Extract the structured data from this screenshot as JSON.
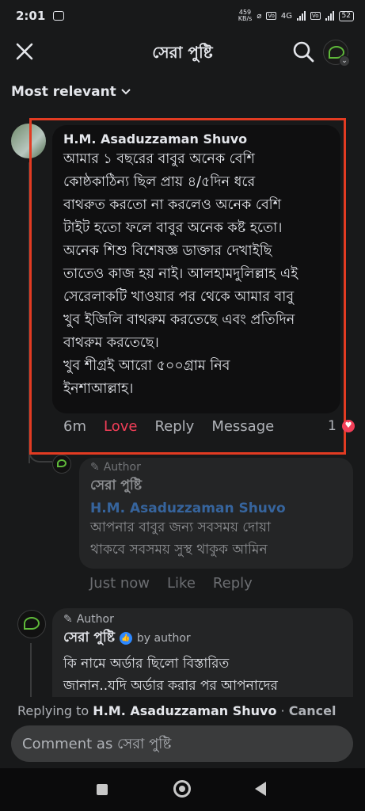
{
  "status_bar": {
    "time": "2:01",
    "net_speed": "459",
    "net_unit": "KB/s",
    "signal": "4G",
    "battery": "52"
  },
  "header": {
    "title": "সেরা পুষ্টি"
  },
  "sort": {
    "label": "Most relevant"
  },
  "comment": {
    "author": "H.M. Asaduzzaman Shuvo",
    "text": "আমার ১ বছরের বাবুর অনেক বেশি\nকোষ্ঠকাঠিন্য ছিল প্রায় ৪/৫দিন ধরে\nবাথরুত করতো না করলেও অনেক বেশি\nটাইট হতো ফলে বাবুর অনেক কষ্ট হতো।\nঅনেক শিশু বিশেষজ্ঞ ডাক্তার দেখাইছি\nতাতেও কাজ হয় নাই। আলহামদুলিল্লাহ এই\nসেরেলাকটি খাওয়ার পর থেকে আমার বাবু\nখুব ইজিলি বাথরুম করতেছে এবং প্রতিদিন\nবাথরুম করতেছে।\nখুব শীগ্রই আরো ৫০০গ্রাম নিব\nইনশাআল্লাহ।",
    "time": "6m",
    "love": "Love",
    "reply": "Reply",
    "message": "Message",
    "reaction_count": "1"
  },
  "reply1": {
    "tag": "Author",
    "author": "সেরা পুষ্টি",
    "mention": "H.M. Asaduzzaman Shuvo",
    "text": "আপনার বাবুর জন্য সবসময় দোয়া\nথাকবে সবসময় সুস্থ থাকুক আমিন",
    "time": "Just now",
    "like": "Like",
    "reply": "Reply"
  },
  "reply2": {
    "tag": "Author",
    "author": "সেরা পুষ্টি",
    "by_author": "by author",
    "text": "কি নামে অর্ডার ছিলো বিস্তারিত\nজানান..যদি অর্ডার করার পর আপনাদের"
  },
  "reply_bar": {
    "prefix": "Replying to ",
    "name": "H.M. Asaduzzaman Shuvo",
    "separator": " · ",
    "cancel": "Cancel"
  },
  "composer": {
    "placeholder": "Comment as সেরা পুষ্টি"
  },
  "colors": {
    "highlight": "#e23b22",
    "love": "#f33e58",
    "mention": "#4599ff"
  }
}
